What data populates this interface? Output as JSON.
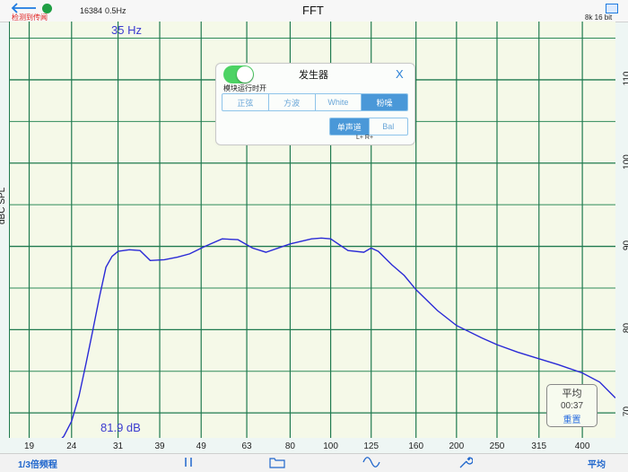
{
  "header": {
    "status_link": "检测到传闻",
    "fft_info_size": "16384",
    "fft_info_res": "0.5Hz",
    "title": "FFT",
    "sample_info": "8k 16 bit",
    "back_icon": "back-arrow-icon",
    "status_dot_color": "#1f9f44",
    "screen_icon": "image-icon"
  },
  "plot": {
    "freq_readout": "35 Hz",
    "level_readout": "81.9 dB",
    "ylabel": "dBC SPL",
    "y_ticks": [
      "110",
      "100",
      "90",
      "80",
      "70"
    ],
    "x_ticks": [
      "19",
      "24",
      "31",
      "39",
      "49",
      "63",
      "80",
      "100",
      "125",
      "160",
      "200",
      "250",
      "315",
      "400"
    ]
  },
  "generator": {
    "title": "发生器",
    "close_label": "X",
    "toggle_state": "on",
    "toggle_label": "模块运行时开",
    "waveforms": [
      "正弦",
      "方波",
      "White",
      "粉噪"
    ],
    "selected_waveform": "粉噪",
    "channels": [
      "单声道",
      "Bal"
    ],
    "selected_channel": "单声道",
    "channel_sublabels": "L+ R+"
  },
  "average": {
    "title": "平均",
    "time": "00:37",
    "reset_label": "重置"
  },
  "toolbar": {
    "left_label": "1/3倍频程",
    "pause_icon": "pause-icon",
    "folder_icon": "folder-icon",
    "wave_icon": "sine-wave-icon",
    "wrench_icon": "wrench-icon",
    "right_label": "平均"
  },
  "chart_data": {
    "type": "line",
    "title": "",
    "xlabel": "",
    "ylabel": "dBC SPL",
    "x_scale": "log",
    "grid": true,
    "xlim": [
      17,
      480
    ],
    "ylim": [
      67,
      117
    ],
    "x": [
      17,
      20,
      22,
      23,
      24,
      25,
      26,
      27,
      28,
      29,
      30,
      31,
      33,
      35,
      37,
      40,
      43,
      46,
      50,
      55,
      60,
      65,
      70,
      80,
      90,
      95,
      100,
      110,
      120,
      125,
      130,
      140,
      150,
      160,
      180,
      200,
      230,
      250,
      280,
      315,
      350,
      400,
      440,
      480
    ],
    "values": [
      65.6,
      65.7,
      66.2,
      67.2,
      69.0,
      72.0,
      76.0,
      80.0,
      84.0,
      87.5,
      88.8,
      89.4,
      89.6,
      89.5,
      88.3,
      88.4,
      88.7,
      89.1,
      90.0,
      90.9,
      90.8,
      89.8,
      89.3,
      90.3,
      90.9,
      91.0,
      90.9,
      89.5,
      89.3,
      89.8,
      89.4,
      87.8,
      86.5,
      84.8,
      82.3,
      80.5,
      79.0,
      78.2,
      77.3,
      76.5,
      75.8,
      74.8,
      73.7,
      71.8
    ],
    "series": [
      {
        "name": "",
        "color": "#2a2ad6"
      }
    ]
  }
}
